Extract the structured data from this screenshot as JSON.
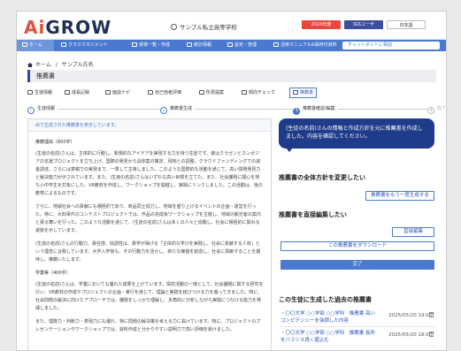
{
  "header": {
    "logo": "AiGROW",
    "school": "サンプル私立高等学校",
    "year": "2024年度",
    "user_badge": "IGSユーザ",
    "language": "日本語"
  },
  "nav": {
    "items": [
      {
        "label": "ホーム"
      },
      {
        "label": "クラスマネジメント"
      },
      {
        "label": "受検一覧・作成"
      },
      {
        "label": "統計情報"
      },
      {
        "label": "設定・管理"
      },
      {
        "label": "活用マニュアル&保存付資料"
      }
    ],
    "chat_button": "チャットボットに相談"
  },
  "breadcrumb": {
    "home": "ホーム",
    "sep": "/",
    "current": "サンプル氏名"
  },
  "page_title": "推薦書",
  "tabs": [
    {
      "label": "生徒情報"
    },
    {
      "label": "成長記録"
    },
    {
      "label": "面談ナビ"
    },
    {
      "label": "自己他者評価"
    },
    {
      "label": "所見提案"
    },
    {
      "label": "傾向チェック"
    },
    {
      "label": "推薦書"
    }
  ],
  "steps": [
    {
      "num": "✓",
      "label": "生徒情報"
    },
    {
      "num": "✓",
      "label": "推薦書生成"
    },
    {
      "num": "3",
      "label": "推薦書確認/編集"
    },
    {
      "num": "4",
      "label": "完了"
    }
  ],
  "left": {
    "notice": "AIで生成された推薦書を表示しています。",
    "section1_title": "推薦理由（600字）",
    "para1": "(生徒の名前)さんは、主体的に行動し、新規的なアイデアを実現する力を持つ生徒です。彼はクラガンとカンボジアの支援プロジェクトを立ち上げ、国際の発見から具体案の策定、現地との調整、クラウドファンディングでの資金調達、さらには寄稿での実現まで、一貫して主導しました。このような国際的な活動を通じて、高い問題発見力と解決能力が示されています。また、(生徒の名前)さんはいずれも高い目標を立てた。また、社会課題に関心を持ち小中学生を対象にした、VR教材を作成し、ワークショップを開催し、実践にリンクしました。この活動は、後の教育によるものです。",
    "para2": "さらに、地域社会への貢献にも積極的であり、商品同士協力し、地域を盛り上げるイベントの企画・運営を行った。特に、大四事件のコンテストプロジェクトでは、作品の完成後ワークショップを主催し、地域の観光客の案内と振る舞いを行った。このような活動を通じて、(生徒の名前)さんは多くの人々と協働し、社会に積極的に関わる姿勢を示しています。",
    "para3": "(生徒の名前)さんの行動力、責任感、協調性は、貴学が掲げる「主体的な学びを実践し、社会に貢献する人材」という理念に合致しています。大学入学後も、その行動力を活かし、新たな価値を創造し、社会に貢献することを期待し、推薦いたします。",
    "section2_title": "学業等（400字）",
    "para4": "(生徒の名前)さんは、学業においても優れた成果を上げています。探究活動の一環として、社会課題に関する研究を行い、VR教材の作成やプロジェクトの企画・実行を通じて、理論と実践を結びつける力を養ってきました。特に、社会問題の解決に向けたアプローチでは、課題をしっかり理解し、多角的に分析しながら実践につなげる能力を発揮しました。",
    "para5": "また、理数力・判断力・表現力にも優れ、特に問題の解決策を考える力に長けています。特に、プロジェクトのプレゼンテーションやワークショップでは、資料作成と分かりやすい説明力で高い評価を受けました。"
  },
  "right": {
    "bubble": "(生徒の名前)さんの情報と作成方針を元に推薦書を作成しました。内容を確認してください。",
    "section_policy": "推薦書の全体方針を変更したい",
    "btn_regenerate": "推薦書をもう一度生成する",
    "section_edit": "推薦書を直接編集したい",
    "btn_edit": "直接編集",
    "btn_download": "この推薦書をダウンロード",
    "btn_done": "完了",
    "section_history": "この生徒に生成した過去の推薦書",
    "history": [
      {
        "title": "・〇〇大学 ○○学部 ○○学科　推薦書 高いコンピテンシーを強調した内容",
        "date": "2025/05/20 19:00"
      },
      {
        "title": "・〇〇大学 ○○学部 ○○学科　推薦書 長所をバランス良く盛込む",
        "date": "2025/05/20 18:00"
      }
    ]
  }
}
